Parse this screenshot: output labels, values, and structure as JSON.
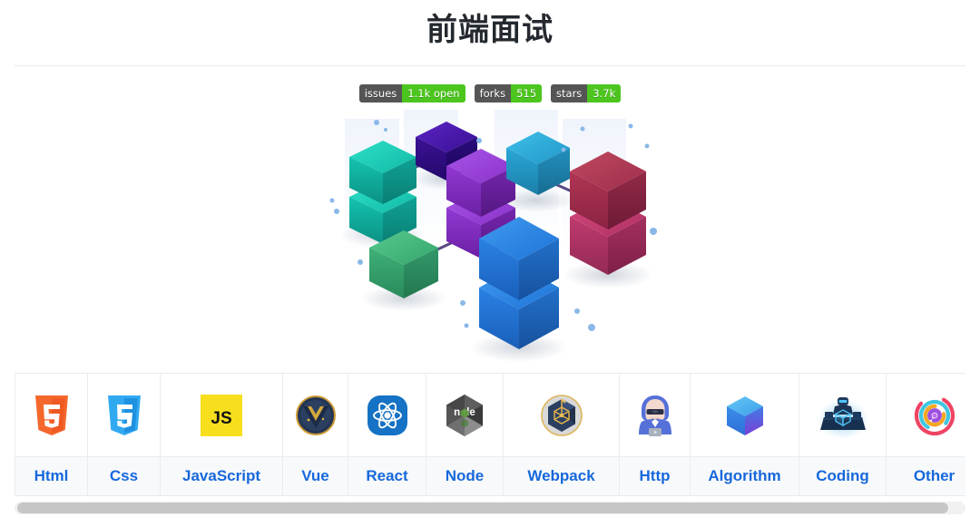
{
  "header": {
    "title": "前端面试",
    "title_color": "#24292f"
  },
  "badges": [
    {
      "label": "issues",
      "value": "1.1k open",
      "label_color": "#555555",
      "value_color": "#4cc61e",
      "name": "issues-badge"
    },
    {
      "label": "forks",
      "value": "515",
      "label_color": "#555555",
      "value_color": "#4cc61e",
      "name": "forks-badge"
    },
    {
      "label": "stars",
      "value": "3.7k",
      "label_color": "#555555",
      "value_color": "#4cc61e",
      "name": "stars-badge"
    }
  ],
  "hero": {
    "alt": "isometric-cubes-illustration",
    "cube_colors": [
      "#14b8a6",
      "#3b0f9e",
      "#8b30c9",
      "#29a3d4",
      "#b32b4f",
      "#2f9e6b",
      "#1d7ae0"
    ]
  },
  "nav": {
    "columns": [
      {
        "label": "Html",
        "icon": "html5-icon"
      },
      {
        "label": "Css",
        "icon": "css3-icon"
      },
      {
        "label": "JavaScript",
        "icon": "javascript-icon"
      },
      {
        "label": "Vue",
        "icon": "vue-icon"
      },
      {
        "label": "React",
        "icon": "react-icon"
      },
      {
        "label": "Node",
        "icon": "nodejs-icon"
      },
      {
        "label": "Webpack",
        "icon": "webpack-icon"
      },
      {
        "label": "Http",
        "icon": "hacker-hoodie-icon"
      },
      {
        "label": "Algorithm",
        "icon": "blue-cube-icon"
      },
      {
        "label": "Coding",
        "icon": "coder-desk-icon"
      },
      {
        "label": "Other",
        "icon": "rainbow-rings-icon"
      }
    ],
    "link_color": "#1668dc",
    "label_row_bg": "#f8f9fa"
  },
  "scrollbar": {
    "orientation": "horizontal",
    "thumb_color": "#c6c6c6",
    "track_color": "#f1f1f1"
  }
}
